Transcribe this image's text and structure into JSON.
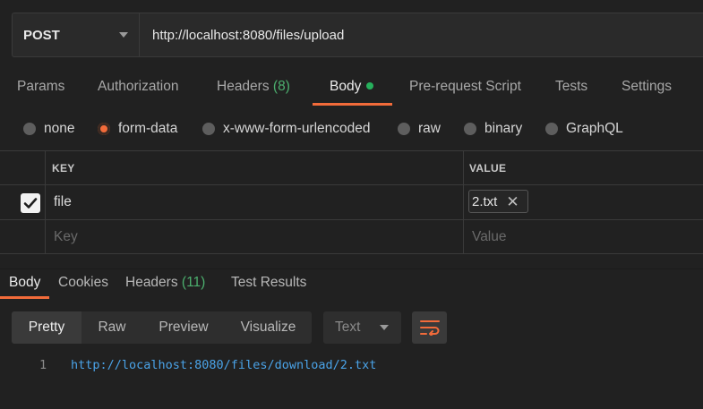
{
  "request": {
    "method": "POST",
    "url": "http://localhost:8080/files/upload"
  },
  "request_tabs": [
    {
      "label": "Params"
    },
    {
      "label": "Authorization"
    },
    {
      "label": "Headers",
      "count": "(8)"
    },
    {
      "label": "Body",
      "active": true,
      "indicator": "green-dot"
    },
    {
      "label": "Pre-request Script"
    },
    {
      "label": "Tests"
    },
    {
      "label": "Settings"
    }
  ],
  "body_types": [
    {
      "label": "none"
    },
    {
      "label": "form-data",
      "selected": true
    },
    {
      "label": "x-www-form-urlencoded"
    },
    {
      "label": "raw"
    },
    {
      "label": "binary"
    },
    {
      "label": "GraphQL"
    }
  ],
  "form_table": {
    "headers": {
      "key": "KEY",
      "value": "VALUE"
    },
    "rows": [
      {
        "checked": true,
        "key": "file",
        "value": "2.txt"
      }
    ],
    "new_row": {
      "key_placeholder": "Key",
      "value_placeholder": "Value"
    }
  },
  "response_tabs": [
    {
      "label": "Body",
      "active": true
    },
    {
      "label": "Cookies"
    },
    {
      "label": "Headers",
      "count": "(11)"
    },
    {
      "label": "Test Results"
    }
  ],
  "format_modes": [
    {
      "label": "Pretty",
      "active": true
    },
    {
      "label": "Raw"
    },
    {
      "label": "Preview"
    },
    {
      "label": "Visualize"
    }
  ],
  "language_select": {
    "value": "Text"
  },
  "response_body": {
    "lines": [
      {
        "number": "1",
        "text": "http://localhost:8080/files/download/2.txt"
      }
    ]
  },
  "colors": {
    "accent": "#f26b3a",
    "success": "#26b05c",
    "background": "#212121",
    "link": "#4aa3e8"
  },
  "icons": [
    "chevron-down-icon",
    "checkmark-icon",
    "close-icon",
    "wrap-lines-icon"
  ]
}
